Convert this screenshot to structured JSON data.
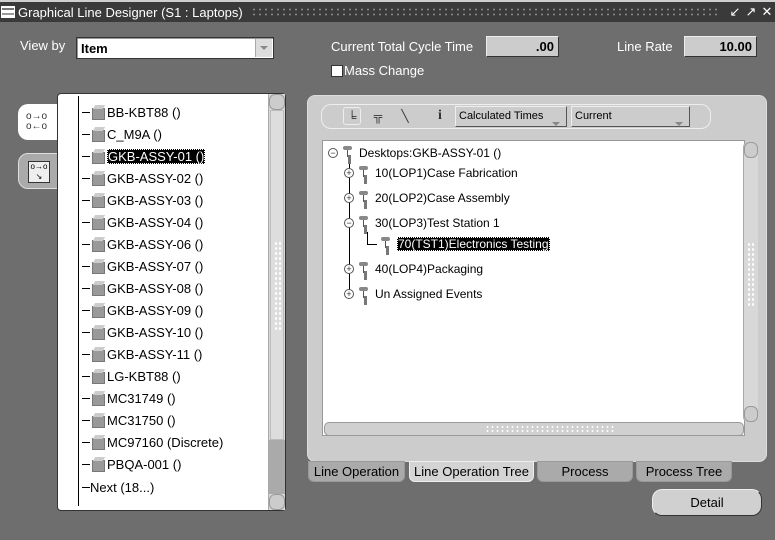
{
  "window": {
    "title": "Graphical Line Designer (S1 : Laptops)",
    "controls": [
      "minimize-icon",
      "maximize-icon",
      "close-icon"
    ]
  },
  "header": {
    "view_by_label": "View by",
    "view_by_value": "Item",
    "cycle_time_label": "Current Total Cycle Time",
    "cycle_time_value": ".00",
    "line_rate_label": "Line Rate",
    "line_rate_value": "10.00",
    "mass_change_label": "Mass Change",
    "mass_change_checked": false
  },
  "item_list": {
    "items": [
      {
        "label": "BB-KBT88 ()"
      },
      {
        "label": "C_M9A ()"
      },
      {
        "label": "GKB-ASSY-01 ()",
        "selected": true
      },
      {
        "label": "GKB-ASSY-02 ()"
      },
      {
        "label": "GKB-ASSY-03 ()"
      },
      {
        "label": "GKB-ASSY-04 ()"
      },
      {
        "label": "GKB-ASSY-06 ()"
      },
      {
        "label": "GKB-ASSY-07 ()"
      },
      {
        "label": "GKB-ASSY-08 ()"
      },
      {
        "label": "GKB-ASSY-09 ()"
      },
      {
        "label": "GKB-ASSY-10 ()"
      },
      {
        "label": "GKB-ASSY-11 ()"
      },
      {
        "label": "LG-KBT88 ()"
      },
      {
        "label": "MC31749 ()"
      },
      {
        "label": "MC31750 ()"
      },
      {
        "label": "MC97160 (Discrete)"
      },
      {
        "label": "PBQA-001 ()"
      }
    ],
    "next_label": "Next (18...)"
  },
  "toolbar": {
    "icons": [
      "vertical-tree-icon",
      "org-chart-icon",
      "diagonal-tree-icon",
      "info-icon"
    ],
    "times_select": "Calculated Times",
    "version_select": "Current"
  },
  "tree": {
    "root": "Desktops:GKB-ASSY-01 ()",
    "nodes": [
      {
        "label": "10(LOP1)Case Fabrication",
        "expanded": false
      },
      {
        "label": "20(LOP2)Case Assembly",
        "expanded": false
      },
      {
        "label": "30(LOP3)Test Station 1",
        "expanded": true,
        "children": [
          {
            "label": "70(TST1)Electronics Testing",
            "selected": true
          }
        ]
      },
      {
        "label": "40(LOP4)Packaging",
        "expanded": false
      },
      {
        "label": "Un Assigned Events",
        "expanded": false
      }
    ]
  },
  "tabs": [
    {
      "label": "Line Operation"
    },
    {
      "label": "Line Operation Tree",
      "active": true
    },
    {
      "label": "Process"
    },
    {
      "label": "Process Tree"
    }
  ],
  "detail_button": "Detail"
}
